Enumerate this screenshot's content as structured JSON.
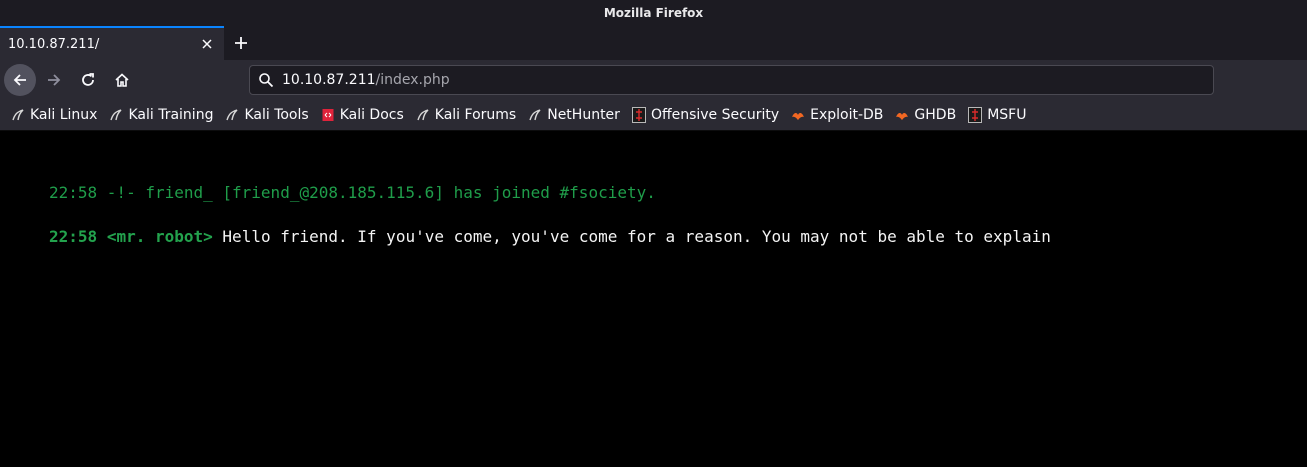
{
  "window": {
    "title": "Mozilla Firefox"
  },
  "tab": {
    "label": "10.10.87.211/"
  },
  "urlbar": {
    "host": "10.10.87.211",
    "path": "/index.php"
  },
  "bookmarks": [
    {
      "label": "Kali Linux",
      "icon": "kali-dragon-icon"
    },
    {
      "label": "Kali Training",
      "icon": "kali-dragon-icon"
    },
    {
      "label": "Kali Tools",
      "icon": "kali-dragon-icon"
    },
    {
      "label": "Kali Docs",
      "icon": "kali-docs-icon"
    },
    {
      "label": "Kali Forums",
      "icon": "kali-dragon-icon"
    },
    {
      "label": "NetHunter",
      "icon": "kali-dragon-icon"
    },
    {
      "label": "Offensive Security",
      "icon": "offsec-icon"
    },
    {
      "label": "Exploit-DB",
      "icon": "exploitdb-icon"
    },
    {
      "label": "GHDB",
      "icon": "exploitdb-icon"
    },
    {
      "label": "MSFU",
      "icon": "offsec-icon"
    }
  ],
  "chat": {
    "line1": "22:58 -!- friend_ [friend_@208.185.115.6] has joined #fsociety.",
    "line2": {
      "time": "22:58",
      "nick": "<mr. robot>",
      "message": "Hello friend. If you've come, you've come for a reason. You may not be able to explain"
    }
  },
  "colors": {
    "chrome_bg": "#1c1b22",
    "toolbar_bg": "#2b2a33",
    "tab_accent": "#0a84ff",
    "irc_green": "#23a24d",
    "page_bg": "#000000"
  }
}
